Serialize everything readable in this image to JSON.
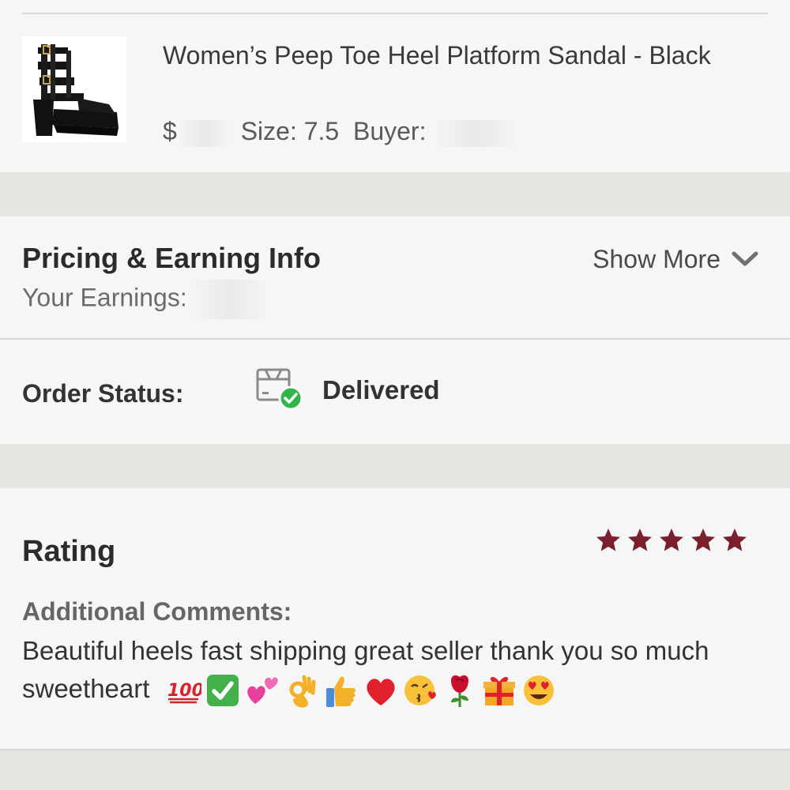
{
  "item": {
    "title": "Women’s Peep Toe Heel Platform Sandal - Black",
    "price_prefix": "$",
    "size_label": "Size:",
    "size_value": "7.5",
    "buyer_label": "Buyer:"
  },
  "pricing": {
    "title": "Pricing & Earning Info",
    "earnings_label": "Your Earnings:",
    "show_more": "Show More"
  },
  "status": {
    "label": "Order Status:",
    "value": "Delivered",
    "icon": "package-delivered-icon"
  },
  "rating": {
    "title": "Rating",
    "stars": 5,
    "max_stars": 5,
    "comments_label": "Additional Comments:",
    "comment_text": "Beautiful heels fast shipping great seller thank you so much sweetheart",
    "emojis": [
      "hundred-points",
      "check-mark-button",
      "two-hearts",
      "ok-hand",
      "thumbs-up",
      "red-heart",
      "face-blowing-kiss",
      "rose",
      "wrapped-gift",
      "heart-eyes"
    ]
  },
  "colors": {
    "star": "#7a1f2b",
    "check_green": "#2fb54a",
    "background": "#e6e4e1",
    "card": "#f7f6f6"
  }
}
